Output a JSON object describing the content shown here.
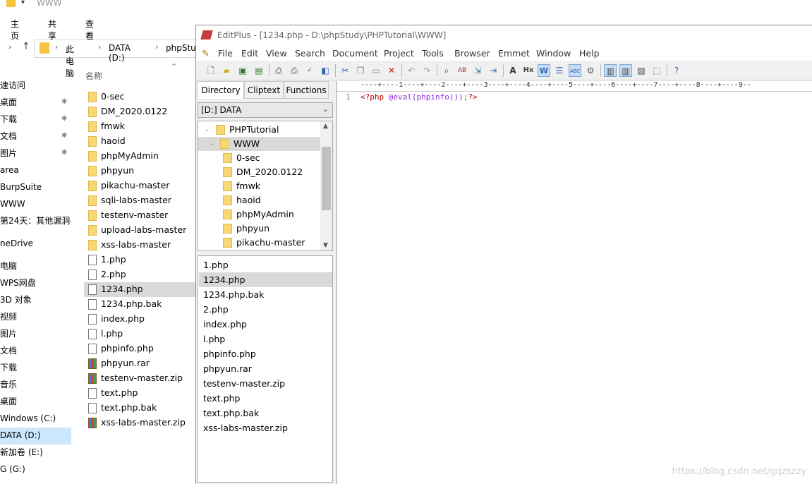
{
  "explorer": {
    "title": "WWW",
    "tabs": [
      "主页",
      "共享",
      "查看"
    ],
    "breadcrumb": [
      "此电脑",
      "DATA (D:)",
      "phpStudy"
    ],
    "column_header": "名称",
    "nav_items": [
      {
        "label": "速访问",
        "pinned": false
      },
      {
        "label": "桌面",
        "pinned": true
      },
      {
        "label": "下载",
        "pinned": true
      },
      {
        "label": "文档",
        "pinned": true
      },
      {
        "label": "图片",
        "pinned": true
      },
      {
        "label": "area",
        "pinned": false
      },
      {
        "label": "BurpSuite",
        "pinned": false
      },
      {
        "label": "WWW",
        "pinned": false
      },
      {
        "label": "第24天：其他漏洞-",
        "pinned": false
      },
      {
        "label": "neDrive",
        "pinned": false
      },
      {
        "label": "电脑",
        "pinned": false
      },
      {
        "label": "WPS网盘",
        "pinned": false
      },
      {
        "label": "3D 对象",
        "pinned": false
      },
      {
        "label": "视频",
        "pinned": false
      },
      {
        "label": "图片",
        "pinned": false
      },
      {
        "label": "文档",
        "pinned": false
      },
      {
        "label": "下载",
        "pinned": false
      },
      {
        "label": "音乐",
        "pinned": false
      },
      {
        "label": "桌面",
        "pinned": false
      },
      {
        "label": "Windows (C:)",
        "pinned": false
      },
      {
        "label": "DATA (D:)",
        "pinned": false,
        "selected": true
      },
      {
        "label": "新加卷 (E:)",
        "pinned": false
      },
      {
        "label": "G (G:)",
        "pinned": false
      }
    ],
    "files": [
      {
        "name": "0-sec",
        "type": "folder"
      },
      {
        "name": "DM_2020.0122",
        "type": "folder"
      },
      {
        "name": "fmwk",
        "type": "folder"
      },
      {
        "name": "haoid",
        "type": "folder"
      },
      {
        "name": "phpMyAdmin",
        "type": "folder"
      },
      {
        "name": "phpyun",
        "type": "folder"
      },
      {
        "name": "pikachu-master",
        "type": "folder"
      },
      {
        "name": "sqli-labs-master",
        "type": "folder"
      },
      {
        "name": "testenv-master",
        "type": "folder"
      },
      {
        "name": "upload-labs-master",
        "type": "folder"
      },
      {
        "name": "xss-labs-master",
        "type": "folder"
      },
      {
        "name": "1.php",
        "type": "file"
      },
      {
        "name": "2.php",
        "type": "file"
      },
      {
        "name": "1234.php",
        "type": "file",
        "selected": true
      },
      {
        "name": "1234.php.bak",
        "type": "file"
      },
      {
        "name": "index.php",
        "type": "file"
      },
      {
        "name": "l.php",
        "type": "file"
      },
      {
        "name": "phpinfo.php",
        "type": "file"
      },
      {
        "name": "phpyun.rar",
        "type": "archive"
      },
      {
        "name": "testenv-master.zip",
        "type": "archive"
      },
      {
        "name": "text.php",
        "type": "file"
      },
      {
        "name": "text.php.bak",
        "type": "file"
      },
      {
        "name": "xss-labs-master.zip",
        "type": "archive"
      }
    ]
  },
  "editplus": {
    "title": "EditPlus - [1234.php - D:\\phpStudy\\PHPTutorial\\WWW]",
    "menu": [
      "File",
      "Edit",
      "View",
      "Search",
      "Document",
      "Project",
      "Tools",
      "Browser",
      "Emmet",
      "Window",
      "Help"
    ],
    "toolbar_icons": [
      "new-icon",
      "open-icon",
      "save-icon",
      "save-all-icon",
      "print-preview-icon",
      "print-icon",
      "spell-check-icon",
      "browser-icon",
      "cut-icon",
      "copy-icon",
      "paste-icon",
      "delete-icon",
      "undo-icon",
      "redo-icon",
      "find-icon",
      "replace-icon",
      "goto-icon",
      "indent-icon",
      "font-icon",
      "hex-icon",
      "word-wrap-icon",
      "line-number-icon",
      "column-icon",
      "settings-icon",
      "dir-window-icon",
      "cliptext-window-icon",
      "output-window-icon",
      "fullscreen-icon",
      "help-icon"
    ],
    "panel_tabs": [
      "Directory",
      "Cliptext",
      "Functions"
    ],
    "drive": "[D:] DATA",
    "tree": [
      {
        "label": "PHPTutorial",
        "level": 0
      },
      {
        "label": "WWW",
        "level": 1,
        "selected": true
      },
      {
        "label": "0-sec",
        "level": 2
      },
      {
        "label": "DM_2020.0122",
        "level": 2
      },
      {
        "label": "fmwk",
        "level": 2
      },
      {
        "label": "haoid",
        "level": 2
      },
      {
        "label": "phpMyAdmin",
        "level": 2
      },
      {
        "label": "phpyun",
        "level": 2
      },
      {
        "label": "pikachu-master",
        "level": 2
      }
    ],
    "file_list": [
      "1.php",
      "1234.php",
      "1234.php.bak",
      "2.php",
      "index.php",
      "l.php",
      "phpinfo.php",
      "phpyun.rar",
      "testenv-master.zip",
      "text.php",
      "text.php.bak",
      "xss-labs-master.zip"
    ],
    "selected_file": "1234.php",
    "ruler": "----+----1----+----2----+----3----+----4----+----5----+----6----+----7----+----8----+----9--",
    "line_number": "1",
    "code": {
      "open": "<?php ",
      "func": "@eval",
      "args": "(phpinfo());",
      "close": "?>"
    },
    "watermark": "https://blog.csdn.net/gqzszzy"
  }
}
